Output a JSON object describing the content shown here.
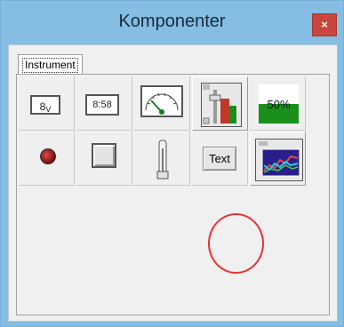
{
  "window": {
    "title": "Komponenter",
    "close_label": "×"
  },
  "tabs": [
    {
      "label": "Instrument"
    }
  ],
  "tools": [
    {
      "name": "digital-display",
      "label": "8",
      "unit": "V"
    },
    {
      "name": "digital-clock",
      "label": "8:58"
    },
    {
      "name": "analog-gauge"
    },
    {
      "name": "slider-control"
    },
    {
      "name": "bar-indicator",
      "label": "50%",
      "value_percent": 50
    },
    {
      "name": "led-indicator"
    },
    {
      "name": "push-button"
    },
    {
      "name": "thermometer"
    },
    {
      "name": "text-label",
      "label": "Text"
    },
    {
      "name": "graph"
    }
  ],
  "colors": {
    "titlebar": "#85bde3",
    "close": "#c9463d",
    "highlight_circle": "#e8322f",
    "bar_fill": "#1a8f1a"
  }
}
